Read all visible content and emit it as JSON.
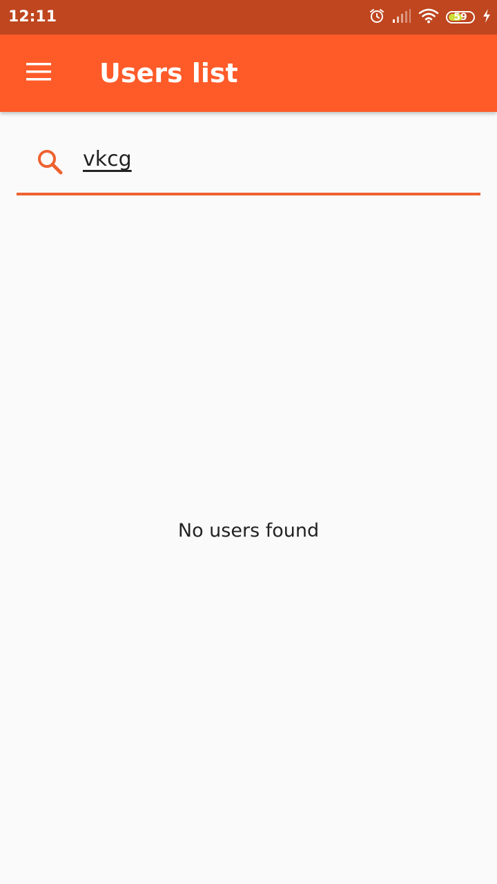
{
  "status_bar": {
    "time": "12:11",
    "battery_percent": "59",
    "battery_level": 0.59,
    "icons": [
      "alarm-icon",
      "signal-icon",
      "wifi-icon",
      "battery-icon",
      "charging-icon"
    ]
  },
  "app_bar": {
    "menu_icon": "hamburger-menu-icon",
    "title": "Users list"
  },
  "search": {
    "icon": "search-icon",
    "value": "vkcg"
  },
  "results": {
    "empty_message": "No users found"
  },
  "colors": {
    "status_bar": "#bf461f",
    "app_bar": "#ff5b29",
    "accent": "#ee6230",
    "background": "#fafafa",
    "cursor": "#3d7ee6"
  }
}
